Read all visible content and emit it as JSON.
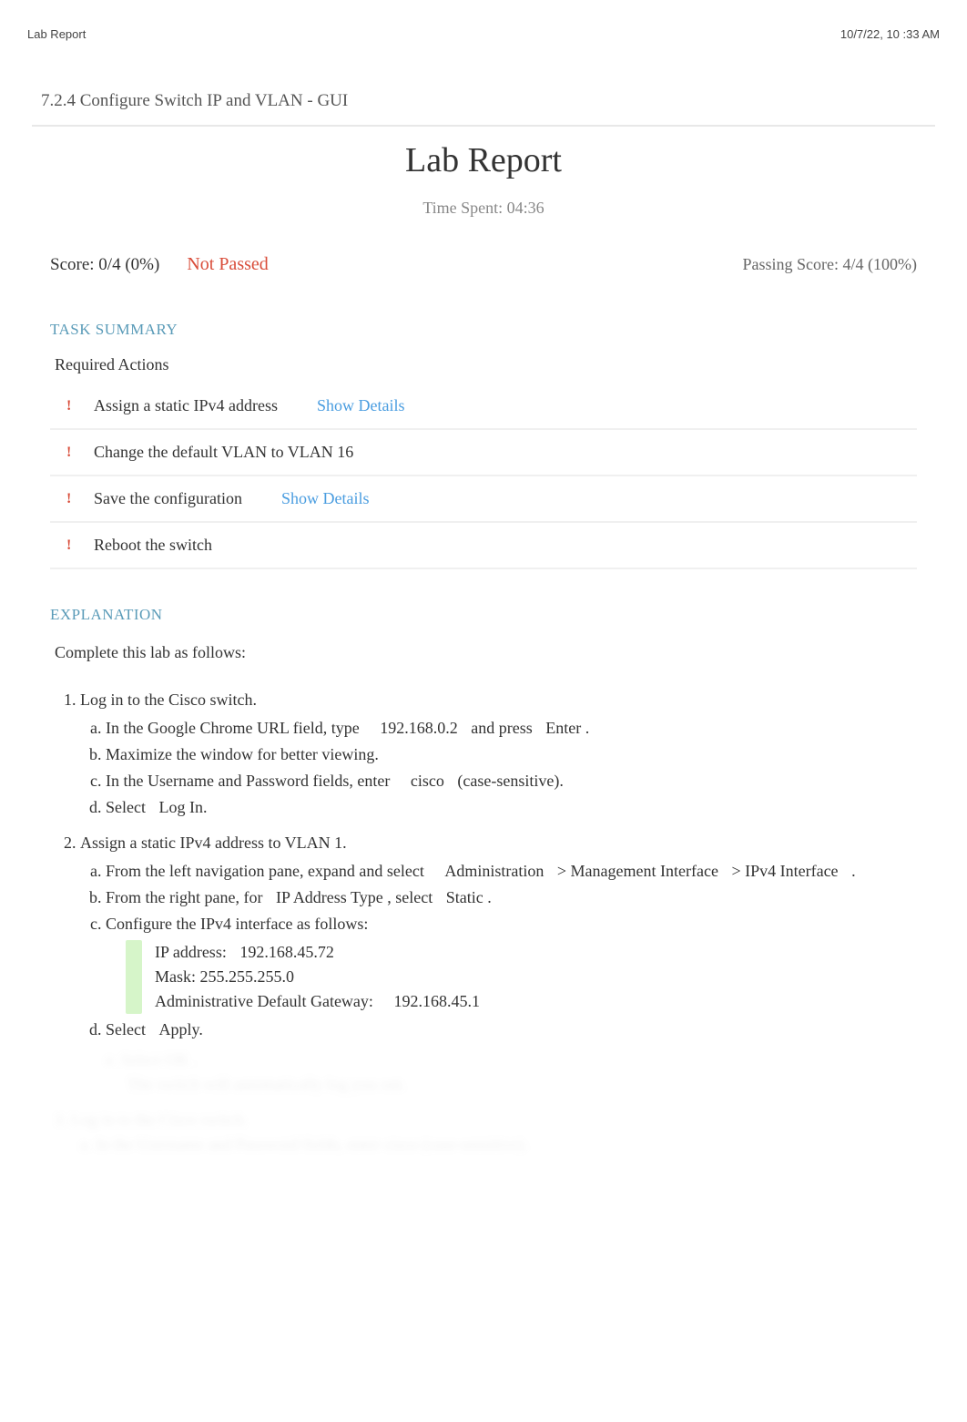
{
  "header": {
    "left": "Lab Report",
    "right": "10/7/22, 10 :33 AM"
  },
  "breadcrumb": "7.2.4 Configure Switch IP and VLAN - GUI",
  "title": "Lab Report",
  "timeSpent": "Time Spent: 04:36",
  "score": {
    "label": "Score: 0/4 (0%)",
    "status": "Not Passed",
    "passing": "Passing Score: 4/4 (100%)"
  },
  "taskSummary": {
    "header": "TASK SUMMARY",
    "requiredLabel": "Required Actions",
    "actions": [
      {
        "text": "Assign a static IPv4 address",
        "showDetails": "Show Details"
      },
      {
        "text": "Change the default VLAN to VLAN 16",
        "showDetails": ""
      },
      {
        "text": "Save the configuration",
        "showDetails": "Show Details"
      },
      {
        "text": "Reboot the switch",
        "showDetails": ""
      }
    ]
  },
  "explanation": {
    "header": "EXPLANATION",
    "intro": "Complete this lab as follows:",
    "step1": {
      "title": "Log in to the Cisco switch.",
      "a_pre": "In the Google Chrome URL field, type",
      "a_ip": "192.168.0.2",
      "a_mid": "and press",
      "a_key": "Enter",
      "a_end": ".",
      "b": "Maximize the window for better viewing.",
      "c_pre": "In the Username and Password fields, enter",
      "c_val": "cisco",
      "c_end": "(case-sensitive).",
      "d_pre": "Select",
      "d_btn": "Log In",
      "d_end": "."
    },
    "step2": {
      "title": "Assign a static IPv4 address to VLAN 1.",
      "a_pre": "From the left navigation pane, expand and select",
      "a_p1": "Administration",
      "a_p2": "> Management Interface",
      "a_p3": "> IPv4 Interface",
      "a_end": ".",
      "b_pre": "From the right pane, for",
      "b_field": "IP Address Type",
      "b_mid": ", select",
      "b_val": "Static",
      "b_end": ".",
      "c": "Configure the IPv4 interface as follows:",
      "cfg_ip_label": "IP address:",
      "cfg_ip_val": "192.168.45.72",
      "cfg_mask_label": "Mask:",
      "cfg_mask_val": "255.255.255.0",
      "cfg_gw_label": "Administrative Default Gateway:",
      "cfg_gw_val": "192.168.45.1",
      "d_pre": "Select",
      "d_btn": "Apply",
      "d_end": "."
    },
    "faded": {
      "e1": "e. Select    OK .",
      "e2": "The switch will automatically log you out.",
      "s3": "3. Log in to the Cisco switch.",
      "s3a": "a. In the Username and Password fields, enter            cisco  (case-sensitive)."
    }
  }
}
